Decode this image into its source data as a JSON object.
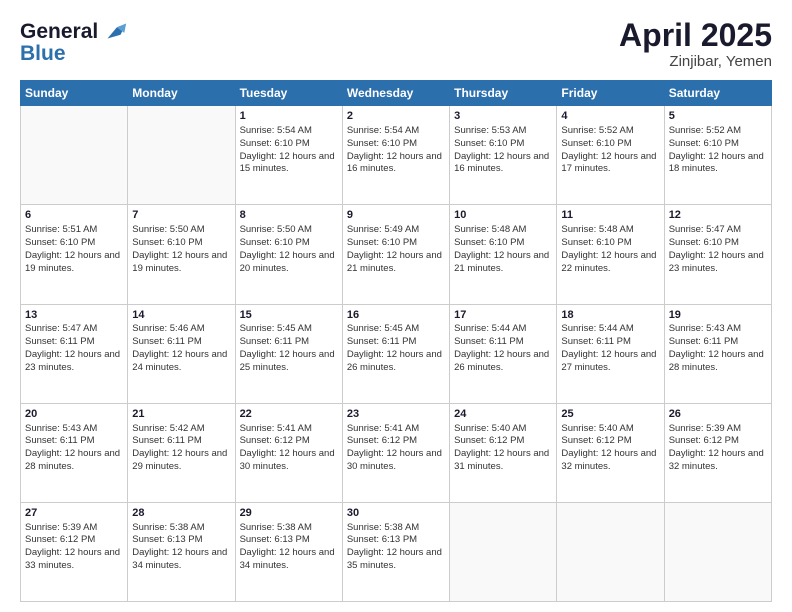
{
  "logo": {
    "line1": "General",
    "line2": "Blue"
  },
  "title": "April 2025",
  "subtitle": "Zinjibar, Yemen",
  "days_header": [
    "Sunday",
    "Monday",
    "Tuesday",
    "Wednesday",
    "Thursday",
    "Friday",
    "Saturday"
  ],
  "weeks": [
    [
      {
        "day": "",
        "info": ""
      },
      {
        "day": "",
        "info": ""
      },
      {
        "day": "1",
        "info": "Sunrise: 5:54 AM\nSunset: 6:10 PM\nDaylight: 12 hours and 15 minutes."
      },
      {
        "day": "2",
        "info": "Sunrise: 5:54 AM\nSunset: 6:10 PM\nDaylight: 12 hours and 16 minutes."
      },
      {
        "day": "3",
        "info": "Sunrise: 5:53 AM\nSunset: 6:10 PM\nDaylight: 12 hours and 16 minutes."
      },
      {
        "day": "4",
        "info": "Sunrise: 5:52 AM\nSunset: 6:10 PM\nDaylight: 12 hours and 17 minutes."
      },
      {
        "day": "5",
        "info": "Sunrise: 5:52 AM\nSunset: 6:10 PM\nDaylight: 12 hours and 18 minutes."
      }
    ],
    [
      {
        "day": "6",
        "info": "Sunrise: 5:51 AM\nSunset: 6:10 PM\nDaylight: 12 hours and 19 minutes."
      },
      {
        "day": "7",
        "info": "Sunrise: 5:50 AM\nSunset: 6:10 PM\nDaylight: 12 hours and 19 minutes."
      },
      {
        "day": "8",
        "info": "Sunrise: 5:50 AM\nSunset: 6:10 PM\nDaylight: 12 hours and 20 minutes."
      },
      {
        "day": "9",
        "info": "Sunrise: 5:49 AM\nSunset: 6:10 PM\nDaylight: 12 hours and 21 minutes."
      },
      {
        "day": "10",
        "info": "Sunrise: 5:48 AM\nSunset: 6:10 PM\nDaylight: 12 hours and 21 minutes."
      },
      {
        "day": "11",
        "info": "Sunrise: 5:48 AM\nSunset: 6:10 PM\nDaylight: 12 hours and 22 minutes."
      },
      {
        "day": "12",
        "info": "Sunrise: 5:47 AM\nSunset: 6:10 PM\nDaylight: 12 hours and 23 minutes."
      }
    ],
    [
      {
        "day": "13",
        "info": "Sunrise: 5:47 AM\nSunset: 6:11 PM\nDaylight: 12 hours and 23 minutes."
      },
      {
        "day": "14",
        "info": "Sunrise: 5:46 AM\nSunset: 6:11 PM\nDaylight: 12 hours and 24 minutes."
      },
      {
        "day": "15",
        "info": "Sunrise: 5:45 AM\nSunset: 6:11 PM\nDaylight: 12 hours and 25 minutes."
      },
      {
        "day": "16",
        "info": "Sunrise: 5:45 AM\nSunset: 6:11 PM\nDaylight: 12 hours and 26 minutes."
      },
      {
        "day": "17",
        "info": "Sunrise: 5:44 AM\nSunset: 6:11 PM\nDaylight: 12 hours and 26 minutes."
      },
      {
        "day": "18",
        "info": "Sunrise: 5:44 AM\nSunset: 6:11 PM\nDaylight: 12 hours and 27 minutes."
      },
      {
        "day": "19",
        "info": "Sunrise: 5:43 AM\nSunset: 6:11 PM\nDaylight: 12 hours and 28 minutes."
      }
    ],
    [
      {
        "day": "20",
        "info": "Sunrise: 5:43 AM\nSunset: 6:11 PM\nDaylight: 12 hours and 28 minutes."
      },
      {
        "day": "21",
        "info": "Sunrise: 5:42 AM\nSunset: 6:11 PM\nDaylight: 12 hours and 29 minutes."
      },
      {
        "day": "22",
        "info": "Sunrise: 5:41 AM\nSunset: 6:12 PM\nDaylight: 12 hours and 30 minutes."
      },
      {
        "day": "23",
        "info": "Sunrise: 5:41 AM\nSunset: 6:12 PM\nDaylight: 12 hours and 30 minutes."
      },
      {
        "day": "24",
        "info": "Sunrise: 5:40 AM\nSunset: 6:12 PM\nDaylight: 12 hours and 31 minutes."
      },
      {
        "day": "25",
        "info": "Sunrise: 5:40 AM\nSunset: 6:12 PM\nDaylight: 12 hours and 32 minutes."
      },
      {
        "day": "26",
        "info": "Sunrise: 5:39 AM\nSunset: 6:12 PM\nDaylight: 12 hours and 32 minutes."
      }
    ],
    [
      {
        "day": "27",
        "info": "Sunrise: 5:39 AM\nSunset: 6:12 PM\nDaylight: 12 hours and 33 minutes."
      },
      {
        "day": "28",
        "info": "Sunrise: 5:38 AM\nSunset: 6:13 PM\nDaylight: 12 hours and 34 minutes."
      },
      {
        "day": "29",
        "info": "Sunrise: 5:38 AM\nSunset: 6:13 PM\nDaylight: 12 hours and 34 minutes."
      },
      {
        "day": "30",
        "info": "Sunrise: 5:38 AM\nSunset: 6:13 PM\nDaylight: 12 hours and 35 minutes."
      },
      {
        "day": "",
        "info": ""
      },
      {
        "day": "",
        "info": ""
      },
      {
        "day": "",
        "info": ""
      }
    ]
  ]
}
